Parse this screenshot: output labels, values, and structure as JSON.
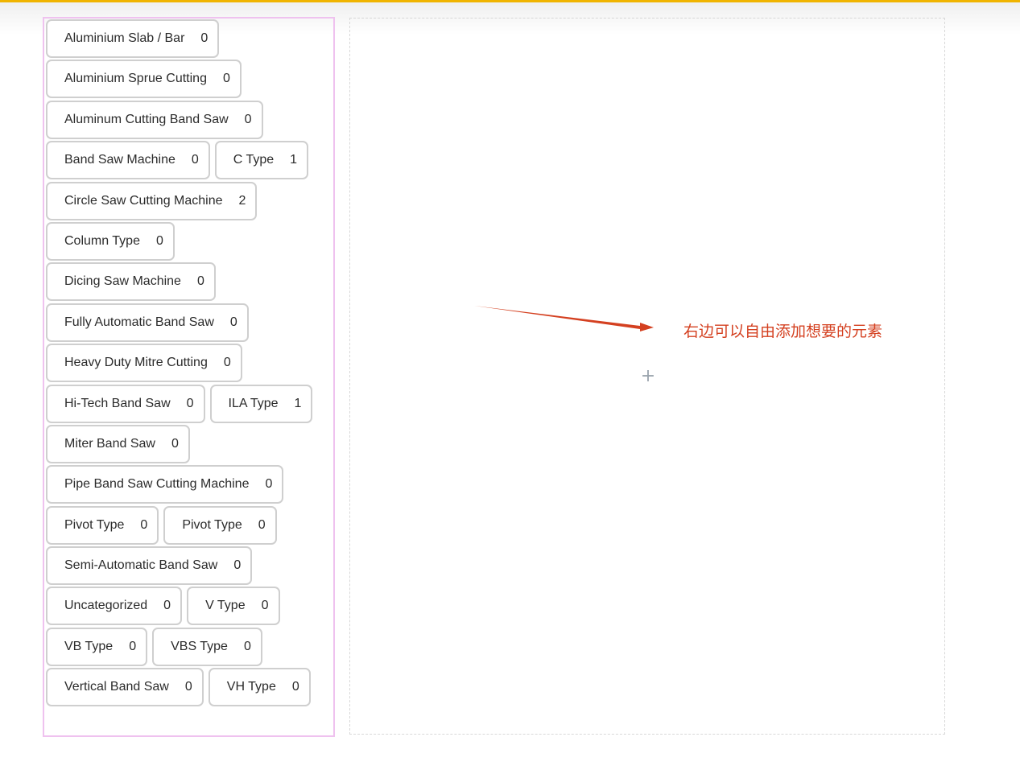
{
  "colors": {
    "accent_bar": "#f0b400",
    "panel_border": "#efc2ef",
    "tag_border": "#cfcfcf",
    "annotation": "#d44020",
    "add_icon": "#9aa4ad"
  },
  "tags": [
    {
      "label": "Aluminium Slab / Bar",
      "count": "0"
    },
    {
      "label": "Aluminium Sprue Cutting",
      "count": "0"
    },
    {
      "label": "Aluminum Cutting Band Saw",
      "count": "0"
    },
    {
      "label": "Band Saw Machine",
      "count": "0"
    },
    {
      "label": "C Type",
      "count": "1"
    },
    {
      "label": "Circle Saw Cutting Machine",
      "count": "2"
    },
    {
      "label": "Column Type",
      "count": "0"
    },
    {
      "label": "Dicing Saw Machine",
      "count": "0"
    },
    {
      "label": "Fully Automatic Band Saw",
      "count": "0"
    },
    {
      "label": "Heavy Duty Mitre Cutting",
      "count": "0"
    },
    {
      "label": "Hi-Tech Band Saw",
      "count": "0"
    },
    {
      "label": "ILA Type",
      "count": "1"
    },
    {
      "label": "Miter Band Saw",
      "count": "0"
    },
    {
      "label": "Pipe Band Saw Cutting Machine",
      "count": "0"
    },
    {
      "label": "Pivot Type",
      "count": "0"
    },
    {
      "label": "Pivot Type",
      "count": "0"
    },
    {
      "label": "Semi-Automatic Band Saw",
      "count": "0"
    },
    {
      "label": "Uncategorized",
      "count": "0"
    },
    {
      "label": "V Type",
      "count": "0"
    },
    {
      "label": "VB Type",
      "count": "0"
    },
    {
      "label": "VBS Type",
      "count": "0"
    },
    {
      "label": "Vertical Band Saw",
      "count": "0"
    },
    {
      "label": "VH Type",
      "count": "0"
    }
  ],
  "canvas": {
    "annotation": "右边可以自由添加想要的元素",
    "add_icon": "plus-icon",
    "add_symbol": "+",
    "arrow_icon": "arrow-right-icon"
  }
}
